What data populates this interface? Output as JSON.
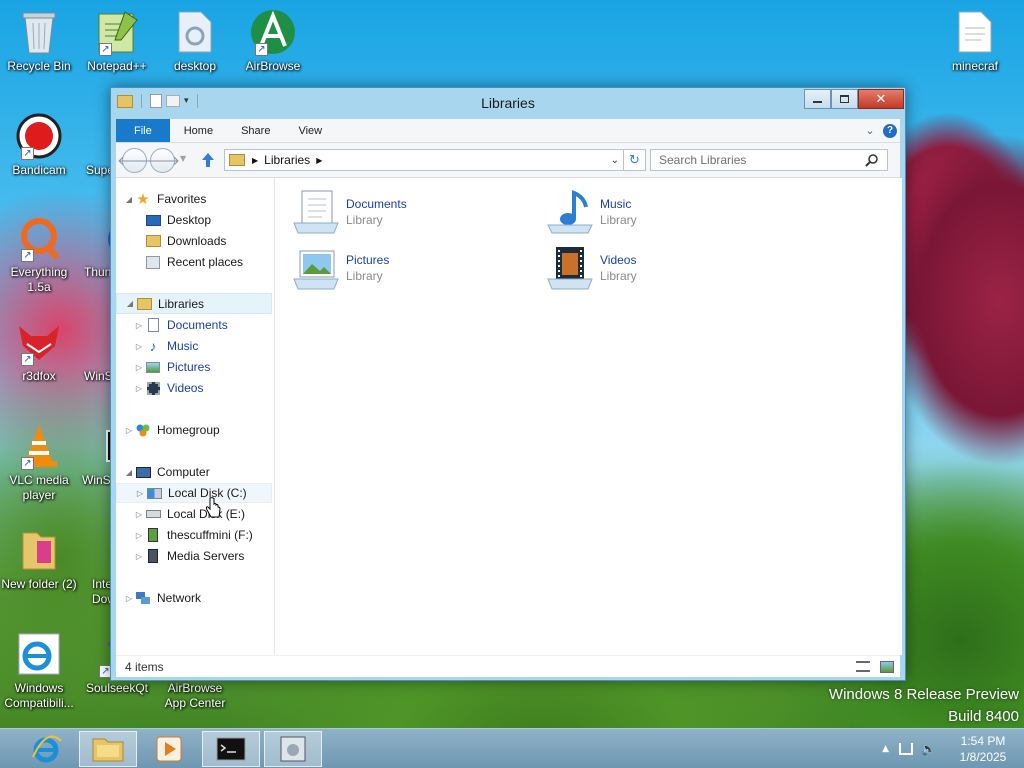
{
  "desktop": {
    "icons": [
      {
        "label": "Recycle Bin"
      },
      {
        "label": "Notepad++"
      },
      {
        "label": "desktop"
      },
      {
        "label": "AirBrowse"
      },
      {
        "label": "minecraf"
      },
      {
        "label": "Bandicam"
      },
      {
        "label": "Supe"
      },
      {
        "label": "Everything 1.5a"
      },
      {
        "label": "Thun"
      },
      {
        "label": "r3dfox"
      },
      {
        "label": "WinS"
      },
      {
        "label": "VLC media player"
      },
      {
        "label": "WinS"
      },
      {
        "label": "New folder (2)"
      },
      {
        "label": "Inte Dow"
      },
      {
        "label": "Windows Compatibili..."
      },
      {
        "label": "SoulseekQt"
      },
      {
        "label": "AirBrowse App Center"
      }
    ],
    "watermark_line1": "Windows 8 Release Preview",
    "watermark_line2": "Build 8400"
  },
  "window": {
    "title": "Libraries",
    "ribbon_tabs": [
      "File",
      "Home",
      "Share",
      "View"
    ],
    "breadcrumb": "Libraries",
    "search_placeholder": "Search Libraries",
    "nav": {
      "favorites": "Favorites",
      "favorites_items": [
        "Desktop",
        "Downloads",
        "Recent places"
      ],
      "libraries": "Libraries",
      "libraries_items": [
        "Documents",
        "Music",
        "Pictures",
        "Videos"
      ],
      "homegroup": "Homegroup",
      "computer": "Computer",
      "computer_items": [
        "Local Disk (C:)",
        "Local Disk (E:)",
        "thescuffmini (F:)",
        "Media Servers"
      ],
      "network": "Network"
    },
    "libraries": [
      {
        "name": "Documents",
        "type": "Library"
      },
      {
        "name": "Music",
        "type": "Library"
      },
      {
        "name": "Pictures",
        "type": "Library"
      },
      {
        "name": "Videos",
        "type": "Library"
      }
    ],
    "status": "4 items"
  },
  "taskbar": {
    "time": "1:54 PM",
    "date": "1/8/2025"
  }
}
